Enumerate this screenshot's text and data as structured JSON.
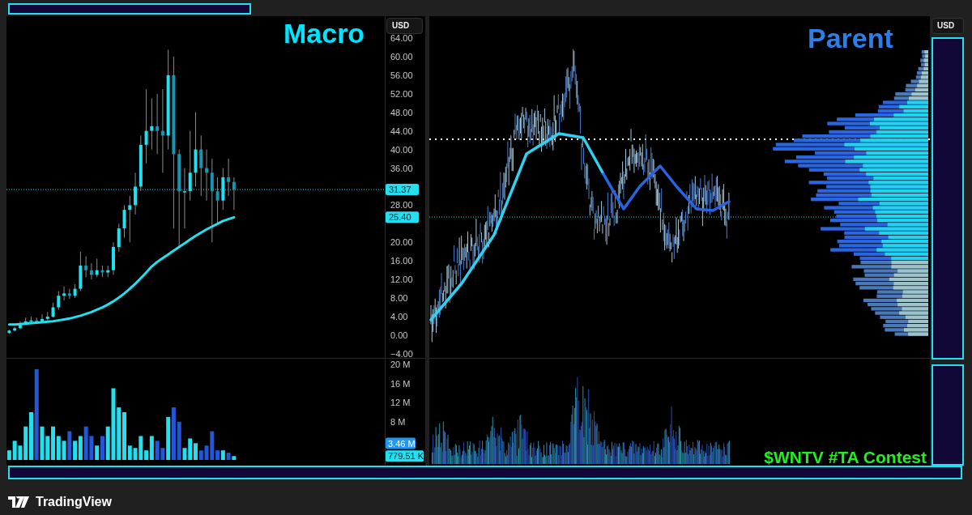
{
  "left_panel": {
    "title": "Macro",
    "currency_button": "USD",
    "price_chart": {
      "chart_data": {
        "type": "candlestick",
        "ylim": [
          -5.06,
          68.7
        ],
        "categories": [
          null,
          null,
          null,
          null,
          null,
          null,
          null,
          null,
          null,
          null,
          null,
          null,
          null,
          null,
          null,
          null,
          null,
          null,
          null,
          null,
          null,
          null,
          null,
          null,
          null,
          null,
          null,
          null,
          null,
          null,
          null,
          null,
          null,
          null,
          null,
          null,
          null,
          null,
          null,
          null,
          null,
          null,
          null,
          null,
          null,
          null,
          null,
          null,
          null,
          null,
          null,
          null,
          null,
          null,
          null,
          null,
          null,
          null,
          null,
          null,
          null,
          null,
          null,
          null,
          null,
          null,
          null,
          null,
          null
        ],
        "yticks": [
          {
            "value": 64,
            "label": "64.00"
          },
          {
            "value": 60,
            "label": "60.00"
          },
          {
            "value": 56,
            "label": "56.00"
          },
          {
            "value": 52,
            "label": "52.00"
          },
          {
            "value": 48,
            "label": "48.00"
          },
          {
            "value": 44,
            "label": "44.00"
          },
          {
            "value": 40,
            "label": "40.00"
          },
          {
            "value": 36,
            "label": "36.00"
          },
          {
            "value": 28,
            "label": "28.00"
          },
          {
            "value": 20,
            "label": "20.00"
          },
          {
            "value": 16,
            "label": "16.00"
          },
          {
            "value": 12,
            "label": "12.00"
          },
          {
            "value": 8,
            "label": "8.00"
          },
          {
            "value": 4,
            "label": "4.00"
          },
          {
            "value": 0,
            "label": "0.00"
          },
          {
            "value": -4,
            "label": "−4.00"
          }
        ],
        "ohlc": [
          [
            0.5,
            1.2,
            0.3,
            1
          ],
          [
            1,
            1.8,
            0.8,
            1.5
          ],
          [
            1.5,
            3,
            1.3,
            2.5
          ],
          [
            2.5,
            3.8,
            2.3,
            3
          ],
          [
            3,
            4,
            2.8,
            3.2
          ],
          [
            3.2,
            3.8,
            2.7,
            3
          ],
          [
            3,
            4.5,
            2.8,
            3.5
          ],
          [
            3.5,
            5,
            3.2,
            4
          ],
          [
            4,
            7,
            3.8,
            6
          ],
          [
            6,
            9.5,
            5.5,
            8.5
          ],
          [
            8.5,
            10.5,
            7.5,
            9
          ],
          [
            9,
            10,
            7.8,
            8.5
          ],
          [
            8.5,
            11,
            8,
            10
          ],
          [
            10,
            18,
            9.5,
            15
          ],
          [
            15,
            17,
            12.5,
            14
          ],
          [
            14,
            15.5,
            12,
            13
          ],
          [
            13,
            16.5,
            12.5,
            14
          ],
          [
            14,
            15,
            12.5,
            13.5
          ],
          [
            13.5,
            15,
            12.5,
            14
          ],
          [
            14,
            20,
            13,
            19
          ],
          [
            19,
            24,
            18,
            23
          ],
          [
            23,
            28,
            21,
            27
          ],
          [
            27,
            30,
            20,
            28
          ],
          [
            28,
            35,
            26,
            32
          ],
          [
            32,
            43,
            31,
            41
          ],
          [
            41,
            53,
            37,
            44
          ],
          [
            44,
            51,
            40,
            45
          ],
          [
            45,
            52,
            39,
            44
          ],
          [
            44,
            53,
            35,
            43
          ],
          [
            43,
            61.5,
            40,
            56
          ],
          [
            56,
            60,
            23,
            39
          ],
          [
            39,
            40,
            19,
            31
          ],
          [
            31,
            36,
            23,
            31
          ],
          [
            31,
            44,
            29,
            35
          ],
          [
            35,
            48,
            32,
            40
          ],
          [
            40,
            43,
            30,
            36
          ],
          [
            36,
            40,
            29,
            35
          ],
          [
            35,
            38,
            20,
            31
          ],
          [
            31,
            34,
            24,
            29
          ],
          [
            29,
            36,
            27,
            34
          ],
          [
            34,
            38,
            30,
            33
          ],
          [
            33,
            34,
            27,
            31.37
          ],
          null,
          null,
          null,
          null,
          null,
          null,
          null,
          null,
          null,
          null,
          null,
          null,
          null,
          null,
          null,
          null,
          null,
          null,
          null,
          null,
          null,
          null,
          null,
          null,
          null,
          null,
          null
        ],
        "series": [
          {
            "type": "line",
            "color": "#22e0f0",
            "values": [
              2.3,
              2.3,
              2.4,
              2.5,
              2.6,
              2.7,
              2.8,
              2.9,
              3.0,
              3.2,
              3.4,
              3.6,
              3.9,
              4.2,
              4.6,
              5.0,
              5.5,
              6.0,
              6.6,
              7.3,
              8.1,
              9.0,
              10.0,
              11.1,
              12.3,
              13.5,
              14.8,
              15.8,
              16.6,
              17.4,
              18.2,
              19.0,
              19.8,
              20.6,
              21.4,
              22.1,
              22.8,
              23.4,
              24.0,
              24.6,
              25.0,
              25.4,
              null,
              null,
              null,
              null,
              null,
              null,
              null,
              null,
              null,
              null,
              null,
              null,
              null,
              null,
              null,
              null,
              null,
              null,
              null,
              null,
              null,
              null,
              null,
              null,
              null,
              null,
              null
            ]
          }
        ],
        "ref_lines": [
          {
            "axis": "y",
            "value": 31.37,
            "label": "31.37",
            "line_style": "dotted"
          }
        ],
        "annotations": [
          "25.40"
        ]
      }
    },
    "volume_chart": {
      "chart_data": {
        "type": "bar",
        "stacked": true,
        "ylim": [
          -1.02,
          21.19
        ],
        "categories": [
          null,
          null,
          null,
          null,
          null,
          null,
          null,
          null,
          null,
          null,
          null,
          null,
          null,
          null,
          null,
          null,
          null,
          null,
          null,
          null,
          null,
          null,
          null,
          null,
          null,
          null,
          null,
          null,
          null,
          null,
          null,
          null,
          null,
          null,
          null,
          null,
          null,
          null,
          null,
          null,
          null,
          null,
          null,
          null,
          null,
          null,
          null,
          null,
          null,
          null,
          null,
          null,
          null,
          null,
          null,
          null,
          null,
          null,
          null,
          null,
          null,
          null,
          null,
          null,
          null,
          null,
          null,
          null,
          null
        ],
        "yticks": [
          {
            "value": 20,
            "label": "20 M"
          },
          {
            "value": 16,
            "label": "16 M"
          },
          {
            "value": 12,
            "label": "12 M"
          },
          {
            "value": 8,
            "label": "8 M"
          }
        ],
        "series": [
          {
            "color": "#22e0f0",
            "values": [
              2,
              4,
              3,
              7,
              10,
              null,
              7,
              5,
              7,
              5,
              4,
              null,
              4,
              5,
              null,
              null,
              3,
              null,
              7,
              15,
              11,
              10,
              3,
              2.5,
              5,
              2,
              5,
              null,
              null,
              9,
              null,
              null,
              2.5,
              4.5,
              3.5,
              null,
              null,
              null,
              null,
              2,
              null,
              0.8,
              null,
              null,
              null,
              null,
              null,
              null,
              null,
              null,
              null,
              null,
              null,
              null,
              null,
              null,
              null,
              null,
              null,
              null,
              null,
              null,
              null,
              null,
              null,
              null,
              null,
              null,
              null
            ]
          },
          {
            "color": "#2456d8",
            "values": [
              null,
              null,
              null,
              null,
              null,
              19,
              null,
              null,
              null,
              null,
              null,
              6,
              null,
              null,
              7,
              5,
              null,
              5,
              null,
              null,
              null,
              null,
              null,
              null,
              null,
              null,
              null,
              4,
              2.5,
              null,
              11,
              8,
              null,
              null,
              null,
              2,
              3,
              6,
              2,
              null,
              1.5,
              null,
              null,
              null,
              null,
              null,
              null,
              null,
              null,
              null,
              null,
              null,
              null,
              null,
              null,
              null,
              null,
              null,
              null,
              null,
              null,
              null,
              null,
              null,
              null,
              null,
              null,
              null,
              null
            ]
          }
        ],
        "annotations": [
          {
            "text": "3.46 M",
            "y": 3.46
          },
          "779.51 K"
        ]
      }
    }
  },
  "right_panel": {
    "title": "Parent",
    "currency_button": "USD",
    "caption": "$WNTV #TA Contest"
  },
  "footer": {
    "brand": "TradingView"
  }
}
